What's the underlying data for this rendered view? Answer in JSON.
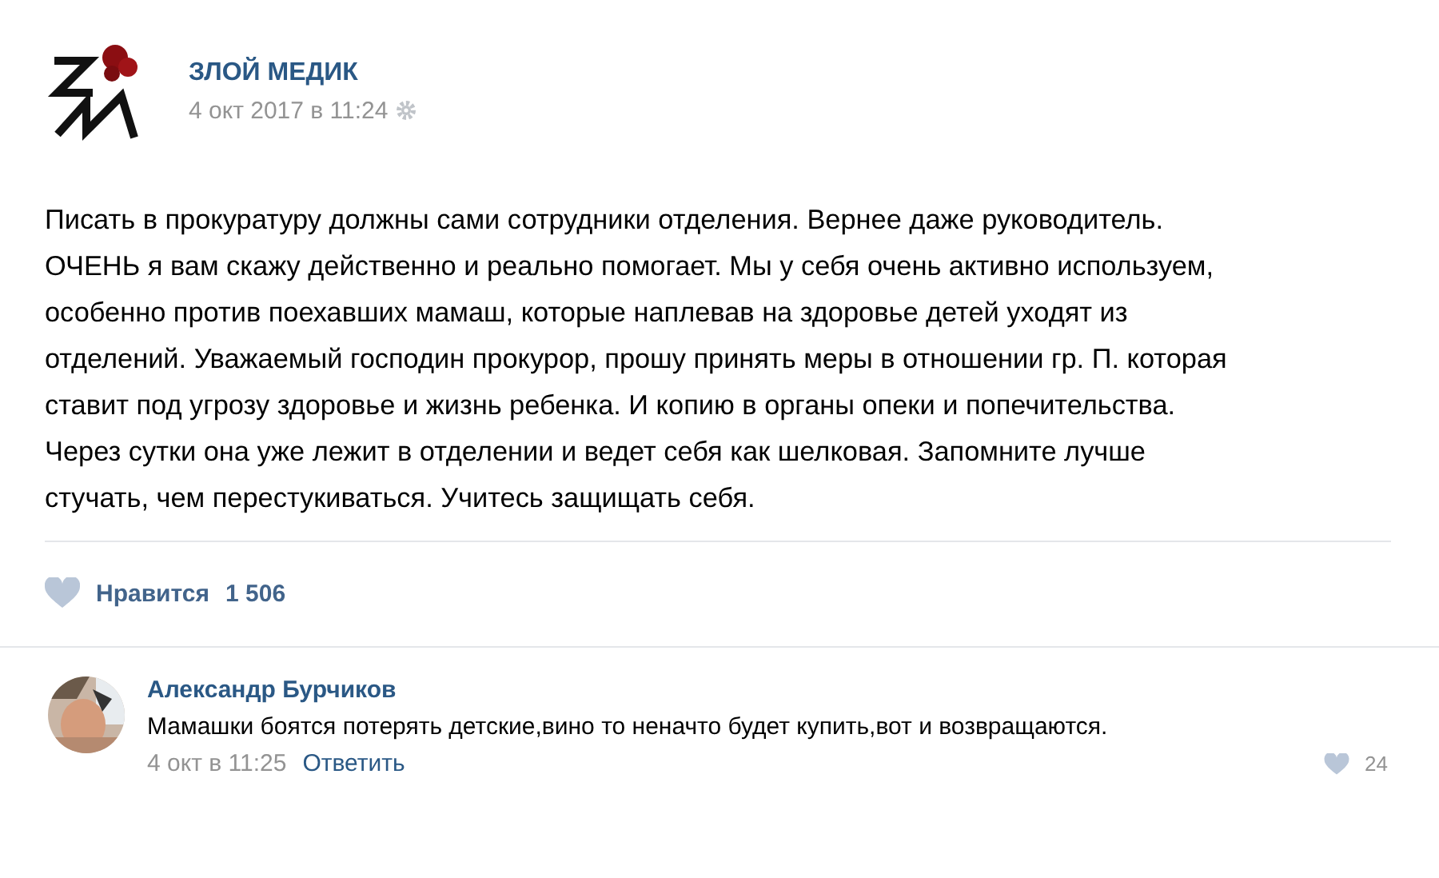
{
  "post": {
    "author": "ЗЛОЙ МЕДИК",
    "date": "4 окт 2017 в 11:24",
    "text": "Писать в прокуратуру должны сами сотрудники отделения. Вернее даже руководитель. ОЧЕНЬ я вам скажу действенно и реально помогает. Мы у себя очень активно используем, особенно против поехавших мамаш, которые наплевав на здоровье детей уходят из отделений. Уважаемый господин прокурор, прошу принять меры в отношении гр. П. которая ставит под угрозу здоровье и жизнь ребенка. И копию в органы опеки и попечительства. Через сутки она уже лежит в отделении и ведет себя как шелковая. Запомните лучше стучать, чем перестукиваться. Учитесь защищать себя.",
    "like_label": "Нравится",
    "like_count": "1 506"
  },
  "comment": {
    "author": "Александр Бурчиков",
    "text": "Мамашки боятся потерять детские,вино то неначто будет купить,вот и возвращаются.",
    "date": "4 окт в 11:25",
    "reply": "Ответить",
    "like_count": "24"
  }
}
